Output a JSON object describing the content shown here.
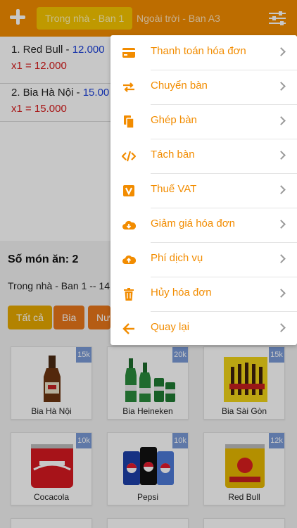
{
  "header": {
    "tabs": [
      {
        "label": "Trong nhà - Ban 1",
        "active": true
      },
      {
        "label": "Ngoài trời - Ban A3",
        "active": false
      }
    ]
  },
  "order": {
    "items": [
      {
        "name": "1. Red Bull - ",
        "price": "12.000",
        "qty": "x1 = 12.000"
      },
      {
        "name": "2. Bia Hà Nội - ",
        "price": "15.00",
        "qty": "x1 = 15.000"
      }
    ],
    "count_text": "Số món ăn: 2",
    "table_info": "Trong nhà - Ban 1 -- 14"
  },
  "categories": [
    {
      "label": "Tất cả"
    },
    {
      "label": "Bia"
    },
    {
      "label": "Nư"
    }
  ],
  "products": [
    {
      "name": "Bia Hà Nội",
      "badge": "15k"
    },
    {
      "name": "Bia Heineken",
      "badge": "20k"
    },
    {
      "name": "Bia Sài Gòn",
      "badge": "15k"
    },
    {
      "name": "Cocacola",
      "badge": "10k"
    },
    {
      "name": "Pepsi",
      "badge": "10k"
    },
    {
      "name": "Red Bull",
      "badge": "12k"
    }
  ],
  "menu": {
    "items": [
      {
        "label": "Thanh toán hóa đơn",
        "icon": "credit-card-icon"
      },
      {
        "label": "Chuyển bàn",
        "icon": "swap-arrows-icon"
      },
      {
        "label": "Ghép bàn",
        "icon": "copy-icon"
      },
      {
        "label": "Tách bàn",
        "icon": "code-icon"
      },
      {
        "label": "Thuế VAT",
        "icon": "v-badge-icon"
      },
      {
        "label": "Giảm giá hóa đơn",
        "icon": "cloud-download-icon"
      },
      {
        "label": "Phí dịch vụ",
        "icon": "cloud-upload-icon"
      },
      {
        "label": "Hủy hóa đơn",
        "icon": "trash-icon"
      },
      {
        "label": "Quay lại",
        "icon": "back-arrow-icon"
      }
    ]
  },
  "colors": {
    "primary": "#f28c00",
    "tab_active": "#f5c400",
    "price": "#1a3fd9",
    "qty": "#d61a1a",
    "badge": "#7a9ad6"
  }
}
